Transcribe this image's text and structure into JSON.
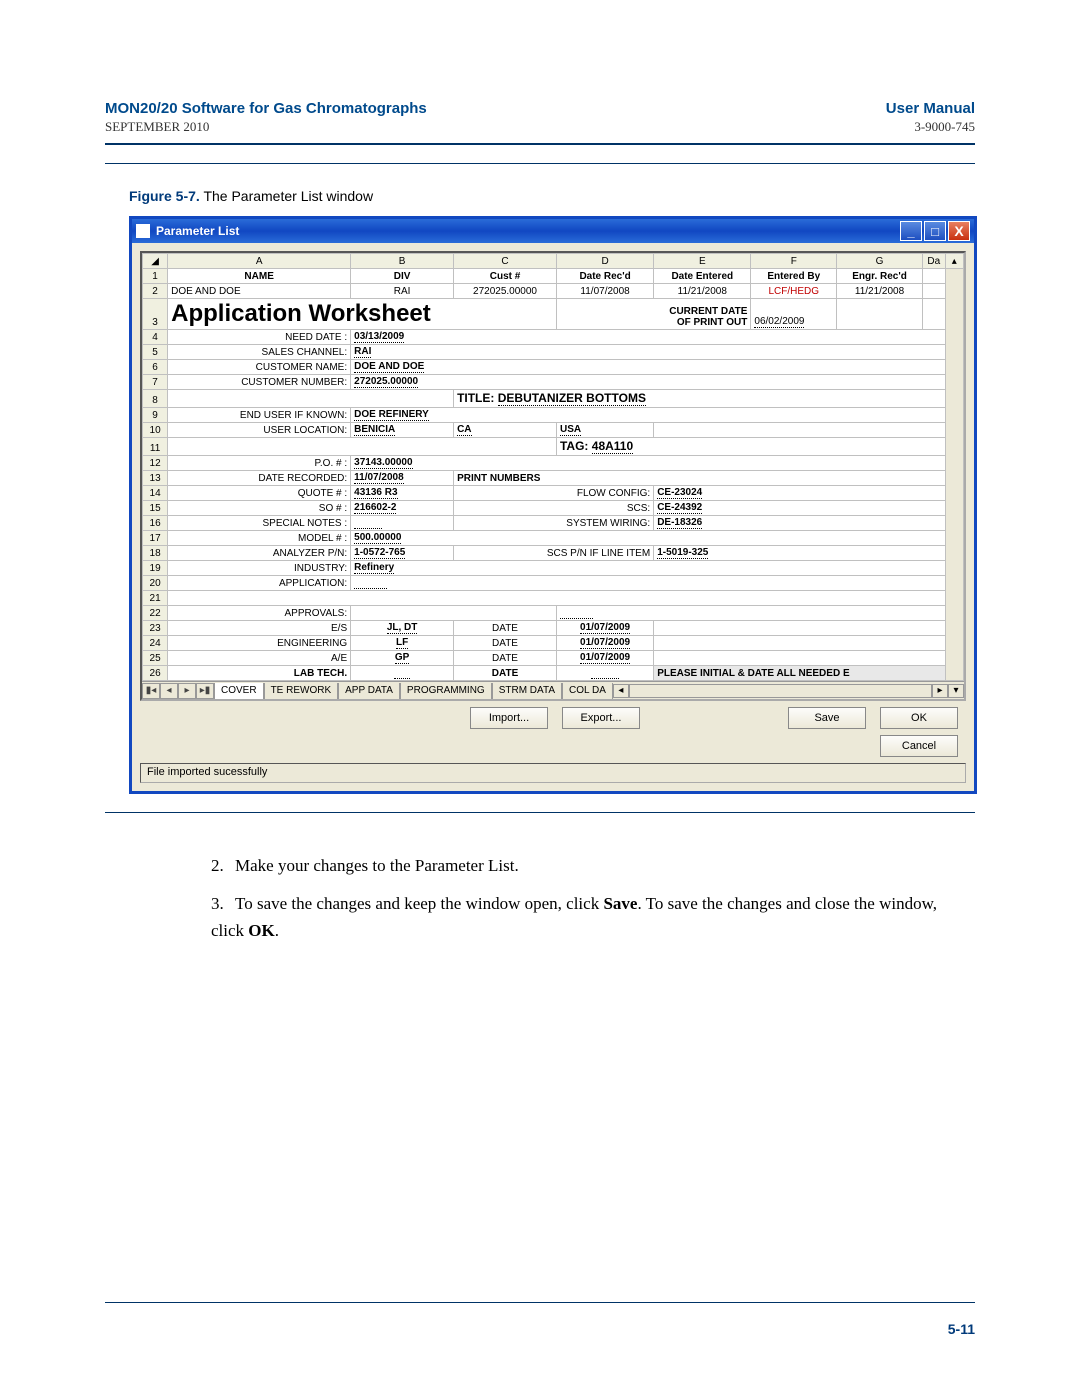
{
  "header": {
    "title_left": "MON20/20 Software for Gas Chromatographs",
    "title_right": "User Manual",
    "sub_left": "SEPTEMBER 2010",
    "sub_right": "3-9000-745"
  },
  "figure": {
    "label": "Figure 5-7.",
    "caption": "The Parameter List window"
  },
  "window": {
    "title": "Parameter List",
    "status": "File imported sucessfully",
    "buttons": {
      "import": "Import...",
      "export": "Export...",
      "save": "Save",
      "ok": "OK",
      "cancel": "Cancel"
    }
  },
  "sheet": {
    "cols": [
      "A",
      "B",
      "C",
      "D",
      "E",
      "F",
      "G"
    ],
    "col_h_partial": "Da",
    "r1": {
      "A": "NAME",
      "B": "DIV",
      "C": "Cust #",
      "D": "Date Rec'd",
      "E": "Date Entered",
      "F": "Entered By",
      "G": "Engr. Rec'd"
    },
    "r2": {
      "A": "DOE AND DOE",
      "B": "RAI",
      "C": "272025.00000",
      "D": "11/07/2008",
      "E": "11/21/2008",
      "F": "LCF/HEDG",
      "G": "11/21/2008"
    },
    "app_ws": "Application Worksheet",
    "r3_curdate_lbl": "CURRENT DATE",
    "r3_printout_lbl": "OF PRINT OUT",
    "r3_printout_val": "06/02/2009",
    "r4_lbl": "NEED DATE :",
    "r4_val": "03/13/2009",
    "r5_lbl": "SALES CHANNEL:",
    "r5_val": "RAI",
    "r6_lbl": "CUSTOMER NAME:",
    "r6_val": "DOE AND DOE",
    "r7_lbl": "CUSTOMER NUMBER:",
    "r7_val": "272025.00000",
    "r8_title_lbl": "TITLE:",
    "r8_title_val": "DEBUTANIZER BOTTOMS",
    "r9_lbl": "END USER IF KNOWN:",
    "r9_val": "DOE REFINERY",
    "r10_lbl": "USER LOCATION:",
    "r10_val": "BENICIA",
    "r10_ca": "CA",
    "r10_usa": "USA",
    "r11_tag_lbl": "TAG:",
    "r11_tag_val": "48A110",
    "r12_lbl": "P.O. # :",
    "r12_val": "37143.00000",
    "r13_lbl": "DATE RECORDED:",
    "r13_val": "11/07/2008",
    "r13_print": "PRINT NUMBERS",
    "r14_lbl": "QUOTE # :",
    "r14_val": "43136 R3",
    "r14_flow_lbl": "FLOW CONFIG:",
    "r14_flow_val": "CE-23024",
    "r15_lbl": "SO # :",
    "r15_val": "216602-2",
    "r15_scs_lbl": "SCS:",
    "r15_scs_val": "CE-24392",
    "r16_lbl": "SPECIAL NOTES :",
    "r16_sys_lbl": "SYSTEM WIRING:",
    "r16_sys_val": "DE-18326",
    "r17_lbl": "MODEL # :",
    "r17_val": "500.00000",
    "r18_lbl": "ANALYZER P/N:",
    "r18_val": "1-0572-765",
    "r18_scs_lbl": "SCS P/N IF LINE ITEM",
    "r18_scs_val": "1-5019-325",
    "r19_lbl": "INDUSTRY:",
    "r19_val": "Refinery",
    "r20_lbl": "APPLICATION:",
    "r22_lbl": "APPROVALS:",
    "r23_lbl": "E/S",
    "r23_val": "JL, DT",
    "r23_date_lbl": "DATE",
    "r23_date": "01/07/2009",
    "r24_lbl": "ENGINEERING",
    "r24_val": "LF",
    "r24_date_lbl": "DATE",
    "r24_date": "01/07/2009",
    "r25_lbl": "A/E",
    "r25_val": "GP",
    "r25_date_lbl": "DATE",
    "r25_date": "01/07/2009",
    "r26_lbl": "LAB TECH.",
    "r26_date_lbl": "DATE",
    "r26_note": "PLEASE INITIAL & DATE ALL NEEDED E",
    "tabs": [
      "COVER",
      "TE REWORK",
      "APP DATA",
      "PROGRAMMING",
      "STRM DATA",
      "COL DA"
    ]
  },
  "steps": {
    "s2_num": "2.",
    "s2": "Make your changes to the Parameter List.",
    "s3_num": "3.",
    "s3a": "To save the changes and keep the window open, click ",
    "s3_save": "Save",
    "s3b": ".  To save the changes and close the window, click ",
    "s3_ok": "OK",
    "s3c": "."
  },
  "page_num": "5-11"
}
